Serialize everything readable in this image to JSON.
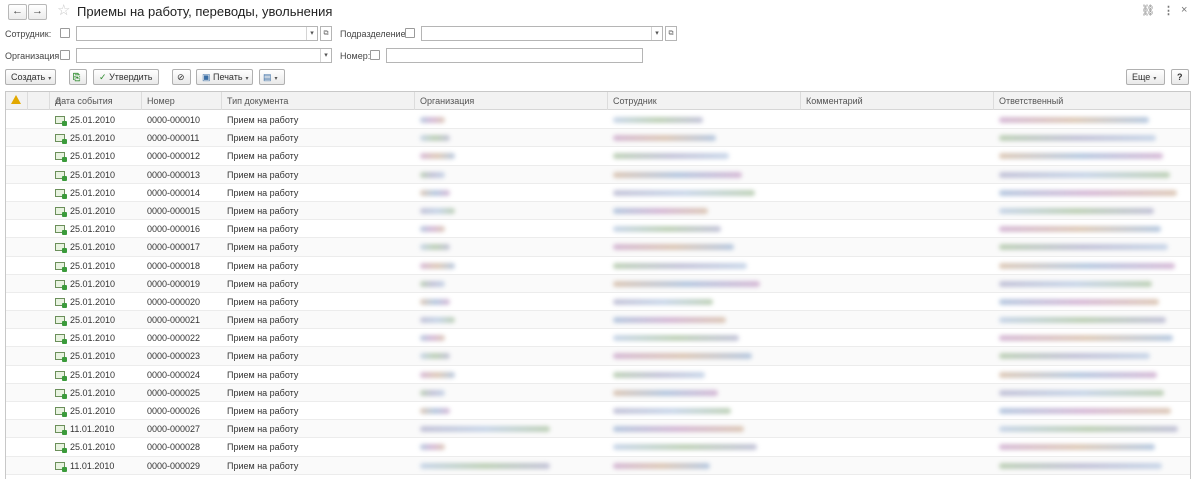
{
  "window": {
    "title": "Приемы на работу, переводы, увольнения",
    "back": "←",
    "forward": "→"
  },
  "filters": {
    "employee_label": "Сотрудник:",
    "department_label": "Подразделение:",
    "organization_label": "Организация:",
    "number_label": "Номер:"
  },
  "toolbar": {
    "create": "Создать",
    "approve": "Утвердить",
    "print": "Печать",
    "more": "Еще",
    "help": "?"
  },
  "table": {
    "columns": {
      "date": "Дата события",
      "number": "Номер",
      "doc_type": "Тип документа",
      "org": "Организация",
      "employee": "Сотрудник",
      "comment": "Комментарий",
      "responsible": "Ответственный"
    },
    "rows": [
      {
        "date": "25.01.2010",
        "number": "0000-000010",
        "type": "Прием на работу"
      },
      {
        "date": "25.01.2010",
        "number": "0000-000011",
        "type": "Прием на работу"
      },
      {
        "date": "25.01.2010",
        "number": "0000-000012",
        "type": "Прием на работу"
      },
      {
        "date": "25.01.2010",
        "number": "0000-000013",
        "type": "Прием на работу"
      },
      {
        "date": "25.01.2010",
        "number": "0000-000014",
        "type": "Прием на работу"
      },
      {
        "date": "25.01.2010",
        "number": "0000-000015",
        "type": "Прием на работу"
      },
      {
        "date": "25.01.2010",
        "number": "0000-000016",
        "type": "Прием на работу"
      },
      {
        "date": "25.01.2010",
        "number": "0000-000017",
        "type": "Прием на работу"
      },
      {
        "date": "25.01.2010",
        "number": "0000-000018",
        "type": "Прием на работу"
      },
      {
        "date": "25.01.2010",
        "number": "0000-000019",
        "type": "Прием на работу"
      },
      {
        "date": "25.01.2010",
        "number": "0000-000020",
        "type": "Прием на работу"
      },
      {
        "date": "25.01.2010",
        "number": "0000-000021",
        "type": "Прием на работу"
      },
      {
        "date": "25.01.2010",
        "number": "0000-000022",
        "type": "Прием на работу"
      },
      {
        "date": "25.01.2010",
        "number": "0000-000023",
        "type": "Прием на работу"
      },
      {
        "date": "25.01.2010",
        "number": "0000-000024",
        "type": "Прием на работу"
      },
      {
        "date": "25.01.2010",
        "number": "0000-000025",
        "type": "Прием на работу"
      },
      {
        "date": "25.01.2010",
        "number": "0000-000026",
        "type": "Прием на работу"
      },
      {
        "date": "11.01.2010",
        "number": "0000-000027",
        "type": "Прием на работу"
      },
      {
        "date": "25.01.2010",
        "number": "0000-000028",
        "type": "Прием на работу"
      },
      {
        "date": "11.01.2010",
        "number": "0000-000029",
        "type": "Прием на работу"
      }
    ]
  },
  "colors": {
    "accent_green": "#3b9b3b",
    "warning": "#e2a800"
  }
}
